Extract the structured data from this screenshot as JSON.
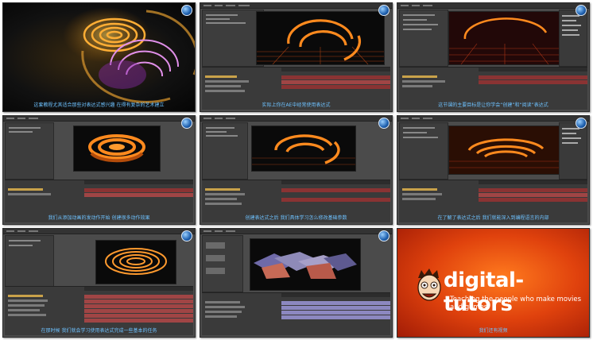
{
  "tiles": [
    {
      "caption": "这套教程尤其适合那些对表达式感兴趣 在得有复杂的艺术建立"
    },
    {
      "caption": "实际上你在AE中经常使用表达式"
    },
    {
      "caption": "这节课的主要目标是让你学会“创建”和“阅读”表达式"
    },
    {
      "caption": "我们从添加动画的发动作开始 创建很多动作效果"
    },
    {
      "caption": "创建表达式之后 我们具体学习怎么修改基础参数"
    },
    {
      "caption": "在了解了表达式之后 我们就能深入到编程语言的内部"
    },
    {
      "caption": "在那时候 我们就会学习使用表达式完成一些基本的任务"
    },
    {
      "caption": ""
    },
    {
      "caption": "我们还有视频"
    }
  ],
  "promo": {
    "brand": "digital-tutors",
    "tagline": "Teaching the people who make movies and games"
  },
  "colors": {
    "caption": "#6ec2ff",
    "ae_bg": "#4b4b4b",
    "orange": "#ff8a1e",
    "promo_red": "#e0420d"
  }
}
